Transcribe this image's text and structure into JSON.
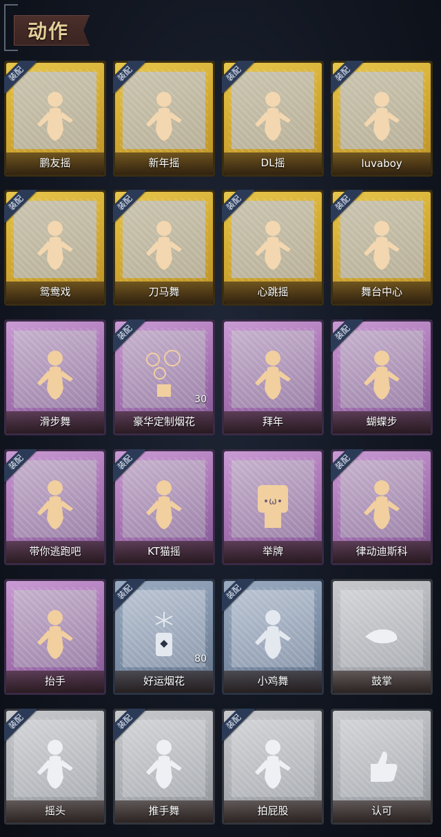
{
  "header": {
    "title": "动作"
  },
  "equip_tag": "装配",
  "items": [
    {
      "label": "鹏友摇",
      "tier": "gold",
      "equipped": true,
      "icon": "dance-figure-icon"
    },
    {
      "label": "新年摇",
      "tier": "gold",
      "equipped": true,
      "icon": "dance-figure-icon"
    },
    {
      "label": "DL摇",
      "tier": "gold",
      "equipped": true,
      "icon": "dance-figure-icon"
    },
    {
      "label": "luvaboy",
      "tier": "gold",
      "equipped": true,
      "icon": "dance-figure-icon"
    },
    {
      "label": "鸳鸯戏",
      "tier": "gold",
      "equipped": true,
      "icon": "dance-figure-icon"
    },
    {
      "label": "刀马舞",
      "tier": "gold",
      "equipped": true,
      "icon": "dance-figure-icon"
    },
    {
      "label": "心跳摇",
      "tier": "gold",
      "equipped": true,
      "icon": "dance-figure-icon"
    },
    {
      "label": "舞台中心",
      "tier": "gold",
      "equipped": true,
      "icon": "dance-figure-icon"
    },
    {
      "label": "滑步舞",
      "tier": "purple",
      "equipped": false,
      "icon": "dance-figure-icon"
    },
    {
      "label": "豪华定制烟花",
      "tier": "purple",
      "equipped": true,
      "icon": "fireworks-box-icon",
      "count": "30"
    },
    {
      "label": "拜年",
      "tier": "purple",
      "equipped": false,
      "icon": "bow-figure-icon"
    },
    {
      "label": "蝴蝶步",
      "tier": "purple",
      "equipped": true,
      "icon": "dance-figure-icon"
    },
    {
      "label": "带你逃跑吧",
      "tier": "purple",
      "equipped": true,
      "icon": "dance-figure-icon"
    },
    {
      "label": "KT猫摇",
      "tier": "purple",
      "equipped": true,
      "icon": "dance-figure-icon"
    },
    {
      "label": "举牌",
      "tier": "purple",
      "equipped": false,
      "icon": "sign-holding-icon"
    },
    {
      "label": "律动迪斯科",
      "tier": "purple",
      "equipped": true,
      "icon": "dance-figure-icon"
    },
    {
      "label": "抬手",
      "tier": "purple",
      "equipped": false,
      "icon": "raise-hand-figure-icon"
    },
    {
      "label": "好运烟花",
      "tier": "blue",
      "equipped": true,
      "icon": "firework-can-icon",
      "count": "80"
    },
    {
      "label": "小鸡舞",
      "tier": "blue",
      "equipped": true,
      "icon": "chicken-dance-figure-icon"
    },
    {
      "label": "鼓掌",
      "tier": "white",
      "equipped": false,
      "icon": "clap-hands-icon"
    },
    {
      "label": "摇头",
      "tier": "white",
      "equipped": true,
      "icon": "shake-head-figure-icon"
    },
    {
      "label": "推手舞",
      "tier": "white",
      "equipped": true,
      "icon": "push-hands-figure-icon"
    },
    {
      "label": "拍屁股",
      "tier": "white",
      "equipped": true,
      "icon": "slap-figure-icon"
    },
    {
      "label": "认可",
      "tier": "white",
      "equipped": false,
      "icon": "thumbs-up-icon"
    }
  ]
}
